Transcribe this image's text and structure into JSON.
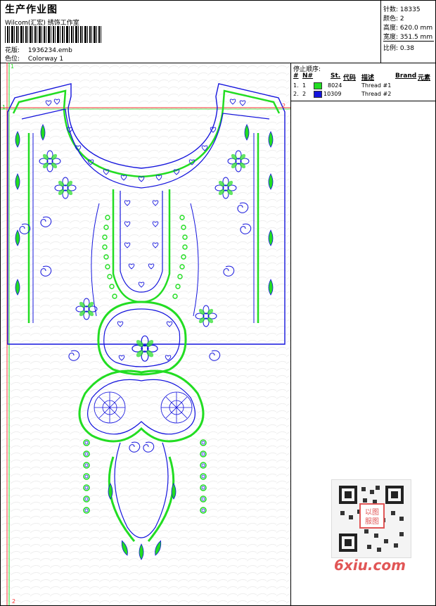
{
  "header": {
    "title": "生产作业图",
    "company": "Wilcom(汇宏) 绣饰工作室",
    "design_label": "花版:",
    "design_file": "1936234.emb",
    "colorway_label": "色位:",
    "colorway": "Colorway 1"
  },
  "stats": {
    "stitches_label": "针数:",
    "stitches": "18335",
    "colors_label": "颜色:",
    "colors": "2",
    "height_label": "高度:",
    "height": "620.0 mm",
    "width_label": "宽度:",
    "width": "351.5 mm",
    "scale_label": "比例:",
    "scale": "0.38"
  },
  "thread_panel": {
    "stop_label": "停止顺序:",
    "columns": {
      "num": "#",
      "n": "N#",
      "st": "St.",
      "code": "代码",
      "desc": "描述",
      "brand": "Brand",
      "elem": "元素"
    },
    "rows": [
      {
        "num": "1.",
        "n": "1",
        "code": "8024",
        "desc": "Thread #1",
        "color": "#22dd22"
      },
      {
        "num": "2.",
        "n": "2",
        "code": "10309",
        "desc": "Thread #2",
        "color": "#1414dd"
      }
    ]
  },
  "markers": {
    "start": "1",
    "end": "2",
    "left": "1",
    "right": "2"
  },
  "watermark": {
    "site": "6xiu.com",
    "seal": "以图 服图"
  },
  "colors": {
    "green": "#22dd22",
    "blue": "#1414dd",
    "guide": "#ff3333"
  }
}
